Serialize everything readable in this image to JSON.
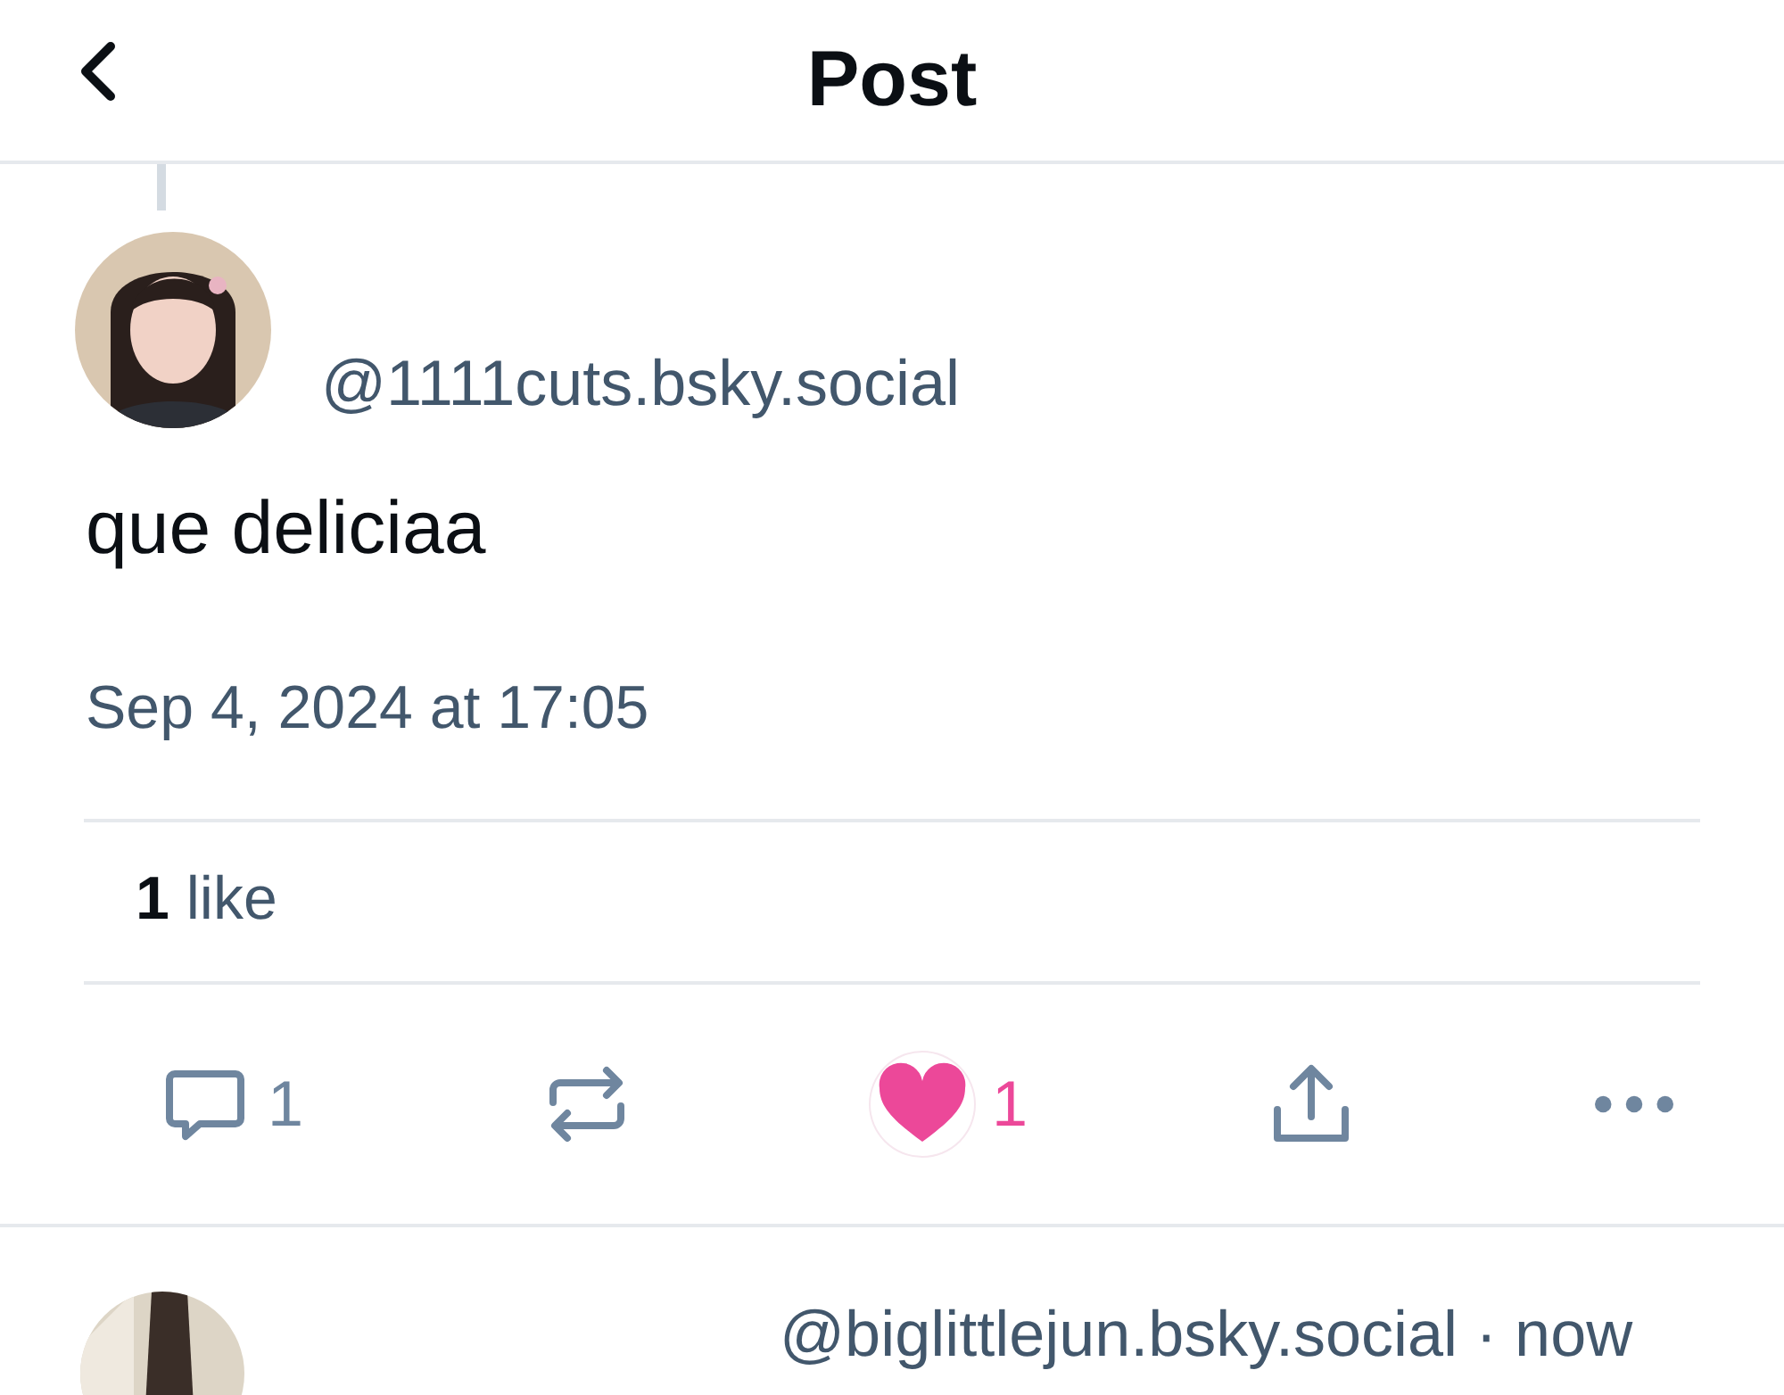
{
  "header": {
    "title": "Post"
  },
  "post": {
    "handle": "@1111cuts.bsky.social",
    "text": "que deliciaa",
    "timestamp": "Sep 4, 2024 at 17:05",
    "like_count": "1",
    "like_label": "like",
    "actions": [
      {
        "kind": "reply",
        "count": "1"
      },
      {
        "kind": "repost"
      },
      {
        "kind": "like",
        "count": "1",
        "selected": true
      },
      {
        "kind": "share"
      },
      {
        "kind": "more"
      }
    ]
  },
  "next_reply": {
    "handle": "@biglittlejun.bsky.social",
    "time": "· now"
  }
}
